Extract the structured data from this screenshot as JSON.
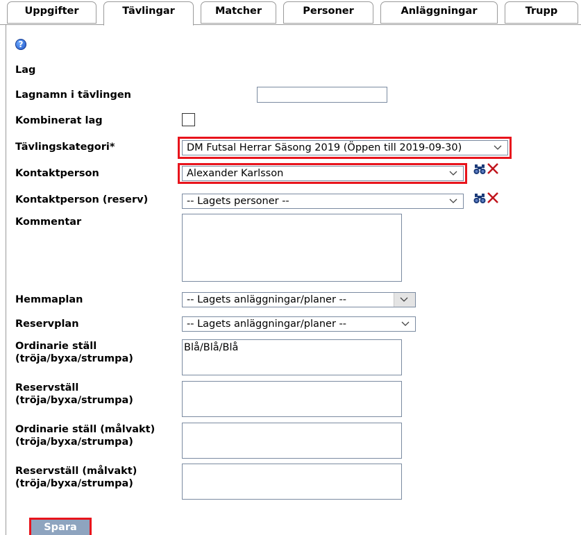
{
  "tabs": [
    {
      "label": "Uppgifter",
      "active": false
    },
    {
      "label": "Tävlingar",
      "active": true
    },
    {
      "label": "Matcher",
      "active": false
    },
    {
      "label": "Personer",
      "active": false
    },
    {
      "label": "Anläggningar",
      "active": false
    },
    {
      "label": "Trupp",
      "active": false
    }
  ],
  "form": {
    "section_title": "Lag",
    "lagnamn": {
      "label": "Lagnamn i tävlingen",
      "value": ""
    },
    "kombinerat": {
      "label": "Kombinerat lag",
      "checked": false
    },
    "kategori": {
      "label": "Tävlingskategori*",
      "value": "DM Futsal Herrar Säsong 2019 (Öppen till 2019-09-30)"
    },
    "kontakt": {
      "label": "Kontaktperson",
      "value": "Alexander Karlsson"
    },
    "kontakt_reserv": {
      "label": "Kontaktperson (reserv)",
      "value": "-- Lagets personer --"
    },
    "kommentar": {
      "label": "Kommentar",
      "value": ""
    },
    "hemmaplan": {
      "label": "Hemmaplan",
      "value": "-- Lagets anläggningar/planer --"
    },
    "reservplan": {
      "label": "Reservplan",
      "value": "-- Lagets anläggningar/planer --"
    },
    "ordinarie": {
      "label": "Ordinarie ställ\n(tröja/byxa/strumpa)",
      "value": "Blå/Blå/Blå"
    },
    "reservstall": {
      "label": "Reservställ\n(tröja/byxa/strumpa)",
      "value": ""
    },
    "ordinarie_mv": {
      "label": "Ordinarie ställ (målvakt)\n(tröja/byxa/strumpa)",
      "value": ""
    },
    "reservstall_mv": {
      "label": "Reservställ (målvakt)\n(tröja/byxa/strumpa)",
      "value": ""
    },
    "save_label": "Spara"
  },
  "icons": {
    "help": "help-icon",
    "search": "binoculars-icon",
    "clear": "close-icon"
  },
  "colors": {
    "highlight": "#e8141c",
    "save_button": "#8ea4bf",
    "help": "#1a4fc2",
    "clear": "#c0141c"
  }
}
